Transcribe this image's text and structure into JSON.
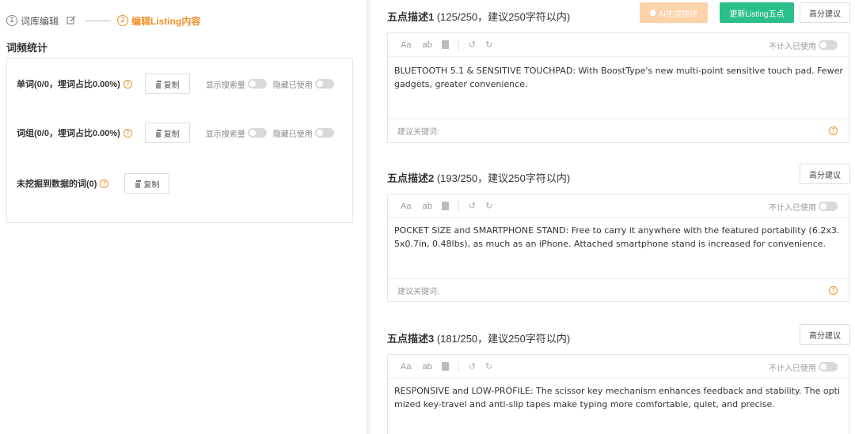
{
  "steps": [
    {
      "num": "1",
      "label": "词库编辑"
    },
    {
      "num": "2",
      "label": "编辑Listing内容"
    }
  ],
  "left": {
    "section_title": "词频统计",
    "rows": [
      {
        "label": "单词(0/0，埋词占比0.00%)",
        "copy": "复制",
        "show_search": "显示搜索量",
        "hide_used": "隐藏已使用"
      },
      {
        "label": "词组(0/0，埋词占比0.00%)",
        "copy": "复制",
        "show_search": "显示搜索量",
        "hide_used": "隐藏已使用"
      },
      {
        "label": "未挖掘到数据的词(0)",
        "copy": "复制"
      }
    ]
  },
  "bullets": [
    {
      "title": "五点描述1",
      "count": " (125/250，建议250字符以内)",
      "ai_btn": "AI生成描述",
      "update_btn": "更新Listing五点",
      "high_btn": "高分建议",
      "toolbar": {
        "aa": "Aa",
        "ab": "ab",
        "exclude_used": "不计入已使用"
      },
      "text": "BLUETOOTH 5.1 & SENSITIVE TOUCHPAD: With BoostType's new multi-point sensitive touch pad. Fewer gadgets, greater convenience.",
      "keywords_label": "建议关键词:"
    },
    {
      "title": "五点描述2",
      "count": " (193/250，建议250字符以内)",
      "high_btn": "高分建议",
      "toolbar": {
        "aa": "Aa",
        "ab": "ab",
        "exclude_used": "不计入已使用"
      },
      "text": "POCKET SIZE and SMARTPHONE STAND: Free to carry it anywhere with the featured portability (6.2x3.5x0.7in, 0.48lbs), as much as an iPhone. Attached smartphone stand is increased for convenience.",
      "keywords_label": "建议关键词:"
    },
    {
      "title": "五点描述3",
      "count": " (181/250，建议250字符以内)",
      "high_btn": "高分建议",
      "toolbar": {
        "aa": "Aa",
        "ab": "ab",
        "exclude_used": "不计入已使用"
      },
      "text": "RESPONSIVE and LOW-PROFILE: The scissor key mechanism enhances feedback and stability. The optimized key-travel and anti-slip tapes make typing more comfortable, quiet, and precise."
    }
  ],
  "colors": {
    "accent": "#f0902c",
    "green": "#2bbf8a",
    "ai_disabled": "#fcd2a9"
  }
}
